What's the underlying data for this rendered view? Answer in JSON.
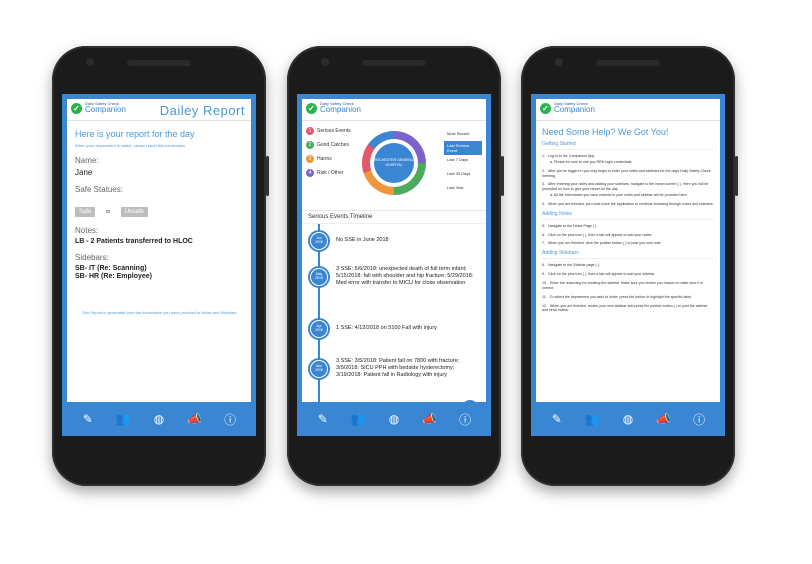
{
  "app": {
    "logo_small": "Daily Safety Check",
    "logo_big": "Companion"
  },
  "tabs": [
    {
      "icon": "notes-icon"
    },
    {
      "icon": "users-icon"
    },
    {
      "icon": "globe-icon"
    },
    {
      "icon": "megaphone-icon"
    },
    {
      "icon": "help-icon"
    }
  ],
  "report": {
    "title": "Dailey Report",
    "intro": "Here is your report for the day",
    "sub": "When your department is called, please report this information",
    "name_label": "Name:",
    "name_value": "Jane",
    "safe_label": "Safe Statues:",
    "safe_btn": "Safe",
    "or": "or",
    "unsafe_btn": "Unsafe",
    "notes_label": "Notes:",
    "notes_value": "LB - 2 Patients transferred to HLOC",
    "sidebars_label": "Sidebars:",
    "sidebar1": "SB- IT (Re: Scanning)",
    "sidebar2": "SB- HR (Re: Employee)",
    "footer": "This Report is generated from the information you have provided in Notes and Sidebars"
  },
  "dashboard": {
    "legend": [
      {
        "num": "1",
        "label": "Serious Events",
        "color": "#e5576b"
      },
      {
        "num": "2",
        "label": "Good Catches",
        "color": "#4caa5c"
      },
      {
        "num": "3",
        "label": "Harms",
        "color": "#f0963b"
      },
      {
        "num": "4",
        "label": "Risk / Other",
        "color": "#7b63c9"
      }
    ],
    "center_label": "ROCHESTER GENERAL HOSPITAL",
    "ranges": [
      "Most Recent",
      "Last Serious Event",
      "Last 7 Days",
      "Last 30 Days",
      "Last Year"
    ],
    "active_range": "Last Serious Event",
    "timeline_title": "Serious Events Timeline",
    "timeline": [
      {
        "month": "Jun",
        "year": "2018",
        "text": "No SSE in June 2018"
      },
      {
        "month": "May",
        "year": "2018",
        "text": "3 SSE: 5/6/2018: unexpected death of full term infant; 5/15/2018: fall with shoulder and hip fracture; 5/29/2018: Med error with transfer to MICU for close observation"
      },
      {
        "month": "Apr",
        "year": "2018",
        "text": "1 SSE: 4/12/2018 on 5100 Fall with injury"
      },
      {
        "month": "Mar",
        "year": "2018",
        "text": "3 SSE: 3/5/2018: Patient fall on 7800 with fracture; 3/9/2018: SICU PPH with bedside hysterectomy; 3/19/2018: Patient fall in Radiology with injury"
      }
    ]
  },
  "help": {
    "title": "Need Some Help? We Got You!",
    "getting_started": "Getting Started",
    "s1": "Log in to the Companion App.",
    "s1a": "a. Please be sure to use you RRH login credentials.",
    "s2": "After you've logged in you may begin to enter your notes and sidebars for the days Daily Safety Check meeting.",
    "s3": "After entering your notes and adding your sidebars, navigate to the report screen (  ). Here you will be prompted on how to give your report for the day.",
    "s3a": "a. All the information you have entered in your notes and sidebar will be provided here.",
    "s4": "When you are finished, you must close the application or continue browsing through notes and sidebars.",
    "adding_notes": "Adding Notes",
    "s5": "Navigate to the Notes Page (  ).",
    "s6": "Click on the plus icon (  ), then a tab will appear to add your notes.",
    "s7": "When you are finished, click the publish button (      ) to post you new note.",
    "adding_sidebars": "Adding Sidebars",
    "s8": "Navigate to the Sidebar page (  ).",
    "s9": "Click on the plus icon (  ), then a tab will appear to add your sidebar.",
    "s10": "Enter the reasoning for creating the sidebar. Make sure you review you reason to make sure it is correct.",
    "s11": "To select the department you wish to invite, press the button to highlight the specific label.",
    "s12": "When you are finished, review your new sidebar and press the publish button (      ) to post the sidebar and send invites."
  }
}
